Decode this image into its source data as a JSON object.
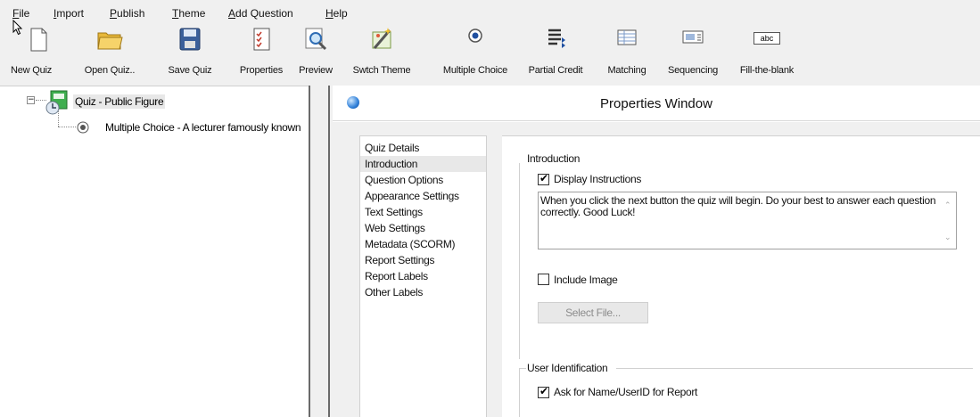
{
  "menu": [
    "File",
    "Import",
    "Publish",
    "Theme",
    "Add Question",
    "Help"
  ],
  "toolbar": {
    "new_quiz": "New Quiz",
    "open_quiz": "Open Quiz..",
    "save_quiz": "Save Quiz",
    "properties": "Properties",
    "preview": "Preview",
    "switch_theme": "Swtch Theme",
    "multiple_choice": "Multiple Choice",
    "partial_credit": "Partial Credit",
    "matching": "Matching",
    "sequencing": "Sequencing",
    "fill_blank": "Fill-the-blank",
    "fill_blank_icon_text": "abc"
  },
  "tree": {
    "root_label": "Quiz - Public Figure",
    "child_label": "Multiple Choice - A lecturer famously known"
  },
  "properties": {
    "title": "Properties Window",
    "nav": [
      "Quiz Details",
      "Introduction",
      "Question Options",
      "Appearance Settings",
      "Text Settings",
      "Web Settings",
      "Metadata (SCORM)",
      "Report Settings",
      "Report Labels",
      "Other Labels"
    ],
    "selected_nav": "Introduction",
    "intro_group": "Introduction",
    "display_instructions_label": "Display Instructions",
    "display_instructions_checked": true,
    "instructions_text": "When you click the next button the quiz will begin. Do your best to answer each question correctly. Good Luck!",
    "include_image_label": "Include Image",
    "include_image_checked": false,
    "select_file_label": "Select File...",
    "user_id_group": "User Identification",
    "ask_name_label": "Ask for Name/UserID for Report",
    "ask_name_checked": true
  },
  "colors": {
    "background": "#f0f0f0",
    "panel": "#ffffff",
    "selection": "#e8e8e8"
  }
}
